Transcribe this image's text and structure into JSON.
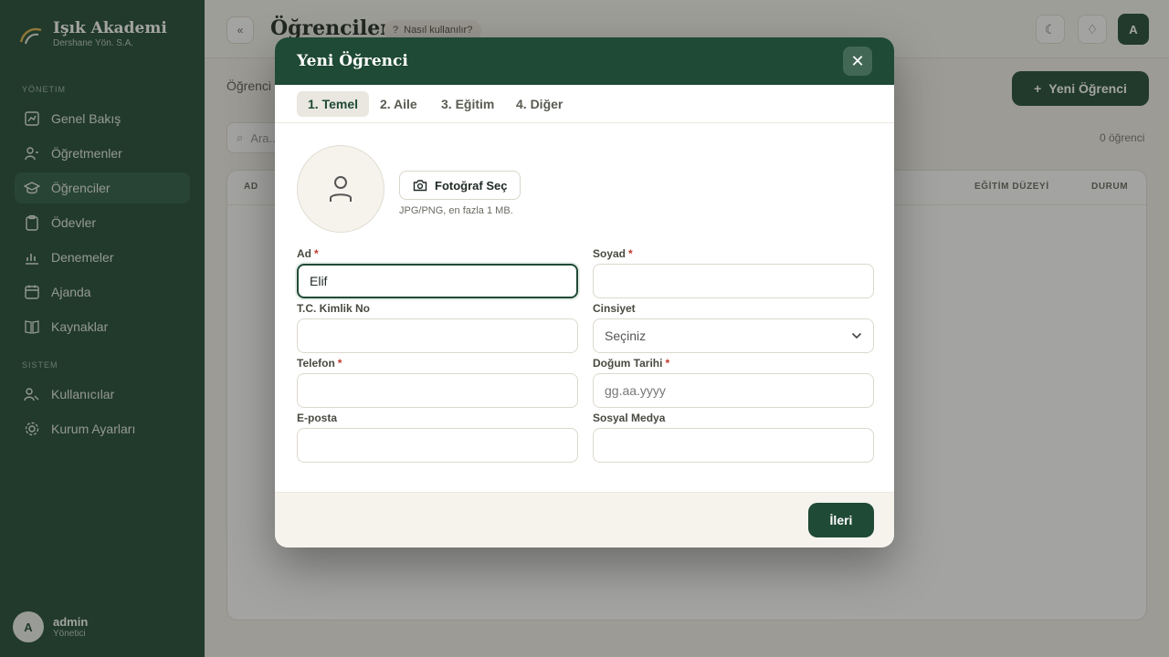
{
  "sidebar": {
    "brand_title": "Işık Akademi",
    "brand_sub": "Dershane Yön. S.A.",
    "section_main": "Yönetim",
    "section_system": "Sistem",
    "items": [
      {
        "label": "Genel Bakış",
        "icon": "dashboard-icon"
      },
      {
        "label": "Öğretmenler",
        "icon": "teacher-icon"
      },
      {
        "label": "Öğrenciler",
        "icon": "student-icon",
        "active": true
      },
      {
        "label": "Ödevler",
        "icon": "clipboard-icon"
      },
      {
        "label": "Denemeler",
        "icon": "chart-icon"
      },
      {
        "label": "Ajanda",
        "icon": "calendar-icon"
      },
      {
        "label": "Kaynaklar",
        "icon": "book-icon"
      }
    ],
    "system_items": [
      {
        "label": "Kullanıcılar",
        "icon": "users-icon"
      },
      {
        "label": "Kurum Ayarları",
        "icon": "settings-icon"
      }
    ],
    "user": {
      "initial": "A",
      "name": "admin",
      "role": "Yönetici"
    }
  },
  "topbar": {
    "collapse": "«",
    "title": "Öğrenciler",
    "help": "Nasıl kullanılır?",
    "avatar_initial": "A"
  },
  "main": {
    "breadcrumb": "Öğrenci Listesi",
    "new_button": "Yeni Öğrenci",
    "search_placeholder": "Ara...",
    "count": "0 öğrenci",
    "columns": [
      "AD",
      "EĞİTİM DÜZEYİ",
      "DURUM"
    ]
  },
  "modal": {
    "title": "Yeni Öğrenci",
    "tabs": [
      "1. Temel",
      "2. Aile",
      "3. Eğitim",
      "4. Diğer"
    ],
    "active_tab": 0,
    "photo_button": "Fotoğraf Seç",
    "photo_hint": "JPG/PNG, en fazla 1 MB.",
    "fields": {
      "ad": {
        "label": "Ad",
        "required": "*",
        "value": "Elif"
      },
      "soyad": {
        "label": "Soyad",
        "required": "*",
        "value": ""
      },
      "tc": {
        "label": "T.C. Kimlik No",
        "value": ""
      },
      "cinsiyet": {
        "label": "Cinsiyet",
        "value": "Seçiniz"
      },
      "telefon": {
        "label": "Telefon",
        "required": "*",
        "value": ""
      },
      "dogum": {
        "label": "Doğum Tarihi",
        "required": "*",
        "placeholder": "gg.aa.yyyy"
      },
      "eposta": {
        "label": "E-posta",
        "value": ""
      },
      "sosyal": {
        "label": "Sosyal Medya",
        "value": ""
      }
    },
    "next_button": "İleri"
  },
  "colors": {
    "brand": "#1f4a35",
    "required": "#c0392b"
  }
}
